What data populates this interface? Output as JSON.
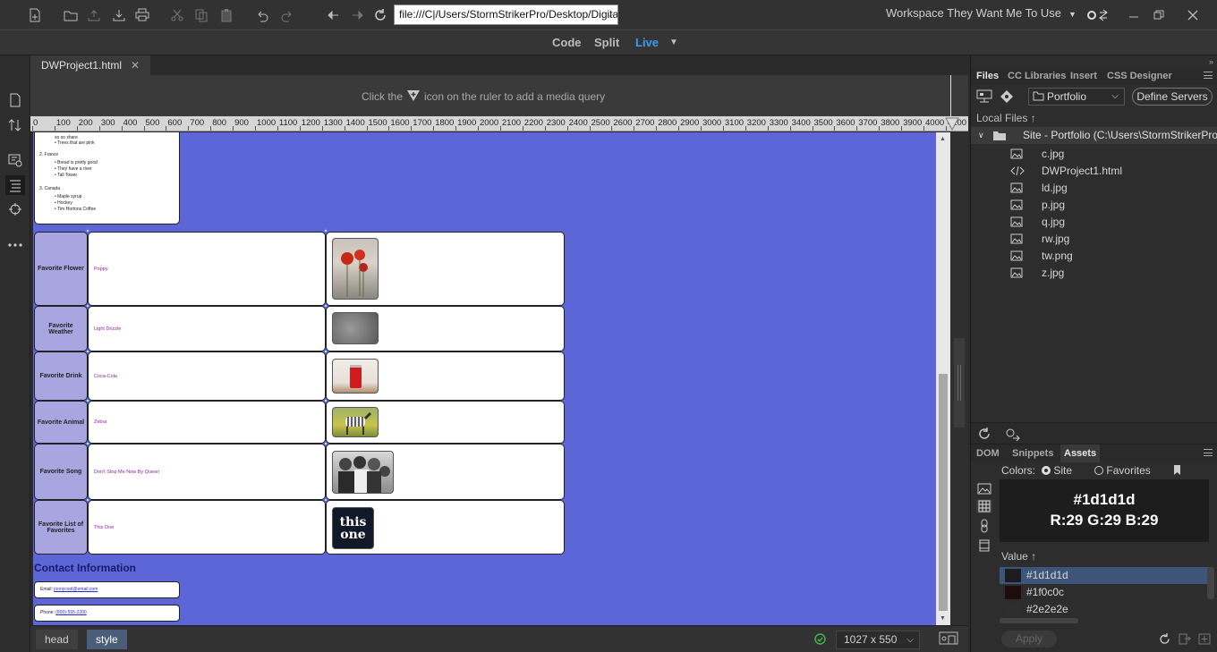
{
  "toolbar": {
    "address": "file:///C|/Users/StormStrikerPro/Desktop/Digita",
    "workspace": "Workspace They Want Me To Use"
  },
  "modes": {
    "code": "Code",
    "split": "Split",
    "live": "Live"
  },
  "document": {
    "tab": "DWProject1.html",
    "media_query_hint_before": "Click the",
    "media_query_hint_after": "icon on the ruler to add a media query",
    "ruler_ticks": [
      "0",
      "100",
      "200",
      "300",
      "400",
      "500",
      "600",
      "700",
      "800",
      "900",
      "1000",
      "1100",
      "1200",
      "1300",
      "1400",
      "1500",
      "1600",
      "1700",
      "1800",
      "1900",
      "2000",
      "2100",
      "2200",
      "2300",
      "2400",
      "2500",
      "2600",
      "2700",
      "2800",
      "2900",
      "3000",
      "3100",
      "3200",
      "3300",
      "3400",
      "3500",
      "3600",
      "3700",
      "3800",
      "3900",
      "4000",
      "4100"
    ]
  },
  "page": {
    "list": {
      "partial_top": "so so share",
      "partial_item": "Trees that are pink",
      "groups": [
        {
          "title": "2. France",
          "items": [
            "Bread is pretty good",
            "They have a river",
            "Tall Tower"
          ]
        },
        {
          "title": "3. Canada",
          "items": [
            "Maple syrup",
            "Hockey",
            "Tim Hortons Coffee"
          ]
        }
      ]
    },
    "favorites": [
      {
        "label": "Favorite Flower",
        "value": "Poppy"
      },
      {
        "label": "Favorite Weather",
        "value": "Light Drizzle"
      },
      {
        "label": "Favorite Drink",
        "value": "Coca-Cola"
      },
      {
        "label": "Favorite Animal",
        "value": "Zebra"
      },
      {
        "label": "Favorite Song",
        "value": "Don't Stop Me Now By Queen"
      },
      {
        "label": "Favorite List of Favorites",
        "value": "This One"
      }
    ],
    "this_one_image_text_1": "this",
    "this_one_image_text_2": "one",
    "contact_title": "Contact Information",
    "email_label": "Email:",
    "email_value": "jonnycool@email.com",
    "phone_label": "Phone:",
    "phone_value": "(800)-555-2200"
  },
  "status": {
    "crumb_head": "head",
    "crumb_style": "style",
    "viewport": "1027 x 550"
  },
  "panel": {
    "top_tabs": [
      "Files",
      "CC Libraries",
      "Insert",
      "CSS Designer"
    ],
    "site": "Portfolio",
    "define_servers": "Define Servers",
    "local_files": "Local Files",
    "site_root": "Site - Portfolio (C:\\Users\\StormStrikerPro\\...",
    "files": [
      {
        "name": "c.jpg",
        "icon": "image-file-icon"
      },
      {
        "name": "DWProject1.html",
        "icon": "code-file-icon"
      },
      {
        "name": "ld.jpg",
        "icon": "image-file-icon"
      },
      {
        "name": "p.jpg",
        "icon": "image-file-icon"
      },
      {
        "name": "q.jpg",
        "icon": "image-file-icon"
      },
      {
        "name": "rw.jpg",
        "icon": "image-file-icon"
      },
      {
        "name": "tw.png",
        "icon": "image-file-icon"
      },
      {
        "name": "z.jpg",
        "icon": "image-file-icon"
      }
    ],
    "bottom_tabs": [
      "DOM",
      "Snippets",
      "Assets"
    ],
    "colors_label": "Colors:",
    "site_radio": "Site",
    "favorites_radio": "Favorites",
    "preview_hex": "#1d1d1d",
    "preview_rgb": "R:29 G:29 B:29",
    "value_header": "Value",
    "colors": [
      {
        "hex": "#1d1d1d"
      },
      {
        "hex": "#1f0c0c"
      },
      {
        "hex": "#2e2e2e"
      }
    ],
    "apply": "Apply"
  }
}
